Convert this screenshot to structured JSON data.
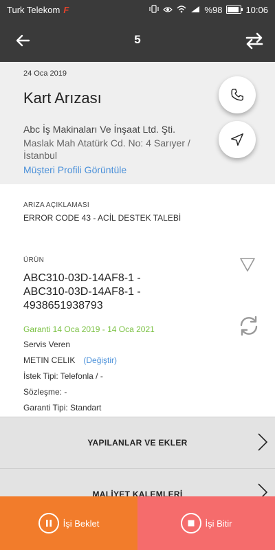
{
  "status_bar": {
    "carrier": "Turk Telekom",
    "carrier_mark": "F",
    "battery_text": "%98",
    "battery_level": 0.98,
    "time": "10:06",
    "icons": [
      "vibrate-icon",
      "eye-icon",
      "wifi-icon",
      "signal-icon",
      "battery-icon"
    ]
  },
  "app_bar": {
    "title": "5",
    "back_icon": "arrow-left-icon",
    "action_icon": "swap-arrows-icon"
  },
  "header": {
    "date": "24 Oca 2019",
    "title": "Kart Arızası",
    "company": "Abc İş Makinaları Ve İnşaat Ltd. Şti.",
    "address": "Maslak Mah Atatürk  Cd. No: 4 Sarıyer / İstanbul",
    "profile_link": "Müşteri Profili Görüntüle"
  },
  "fault": {
    "label": "ARIZA AÇIKLAMASI",
    "text": "ERROR CODE 43 - ACİL DESTEK TALEBİ"
  },
  "product": {
    "label": "ÜRÜN",
    "code_lines": [
      "ABC310-03D-14AF8-1 -",
      "ABC310-03D-14AF8-1 -",
      "4938651938793"
    ],
    "warranty": "Garanti 14 Oca 2019 - 14 Oca 2021",
    "service_label": "Servis Veren",
    "technician": "METIN CELIK",
    "change_link": "(Değiştir)",
    "request_type": "İstek Tipi: Telefonla / -",
    "contract": "Sözleşme:  -",
    "warranty_type": "Garanti Tipi: Standart"
  },
  "menu": {
    "row1": "YAPILANLAR VE EKLER",
    "row2": "MALİYET KALEMLERİ"
  },
  "bottom": {
    "pause_label": "İşi Beklet",
    "finish_label": "İşi Bitir"
  },
  "colors": {
    "appbar": "#3a3a3a",
    "header_bg": "#efefef",
    "link": "#4a90d9",
    "warranty_green": "#7ac142",
    "pause_orange": "#f27c2b",
    "finish_red": "#f56c6c"
  }
}
